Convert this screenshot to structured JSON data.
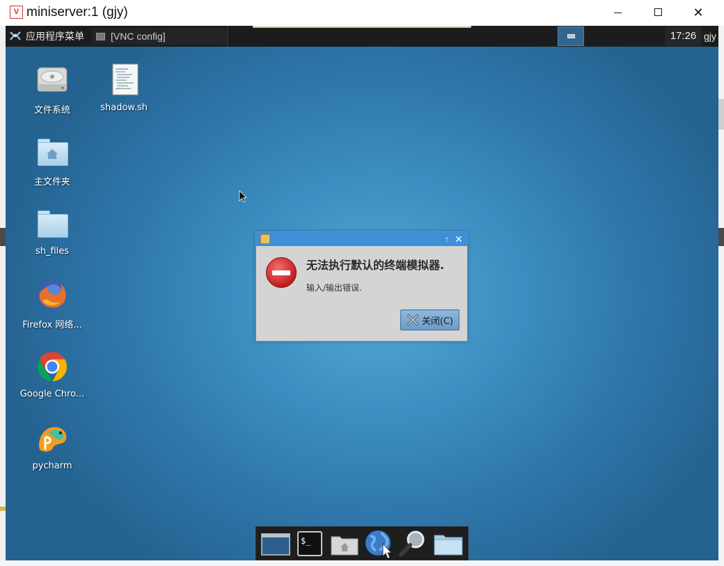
{
  "host_window": {
    "title": "miniserver:1 (gjy)",
    "icon": "vnc-viewer-icon",
    "controls": {
      "minimize": "minimize-icon",
      "maximize": "maximize-icon",
      "close": "✕"
    }
  },
  "top_panel": {
    "apps_menu_label": "应用程序菜单",
    "task_label": "[VNC config]",
    "clock": "17:26",
    "user": "gjy"
  },
  "desktop": {
    "icons": [
      {
        "label": "文件系统",
        "icon": "drive-icon"
      },
      {
        "label": "shadow.sh",
        "icon": "text-file-icon"
      },
      {
        "label": "主文件夹",
        "icon": "home-folder-icon"
      },
      {
        "label": "sh_files",
        "icon": "folder-icon"
      },
      {
        "label": "Firefox 网络...",
        "icon": "firefox-icon"
      },
      {
        "label": "Google Chro...",
        "icon": "chrome-icon"
      },
      {
        "label": "pycharm",
        "icon": "pycharm-icon"
      }
    ]
  },
  "dialog": {
    "heading": "无法执行默认的终端模拟器.",
    "message": "输入/输出错误.",
    "close_button": "关闭(C)",
    "title_buttons": {
      "up": "↑",
      "close": "✕"
    }
  },
  "dock": {
    "items": [
      "desktop-icon",
      "terminal-icon",
      "home-folder-icon",
      "web-browser-icon",
      "search-icon",
      "folder-icon"
    ],
    "terminal_glyph": "$_"
  },
  "colors": {
    "panel": "#1c1c1c",
    "desktop_accent": "#3d8fc2",
    "dialog_title": "#3c8fd8",
    "error_red": "#c21e1e"
  }
}
